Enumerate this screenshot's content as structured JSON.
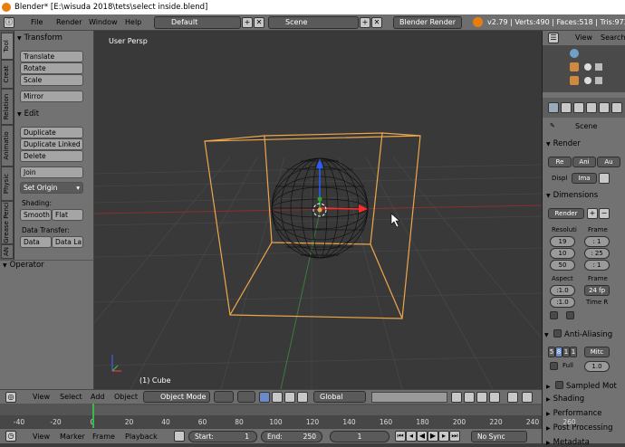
{
  "window": {
    "title": "Blender* [E:\\wisuda 2018\\tets\\select inside.blend]"
  },
  "info_header": {
    "menus": [
      "File",
      "Render",
      "Window",
      "Help"
    ],
    "screen_layout": "Default",
    "scene": "Scene",
    "engine": "Blender Render",
    "stats": "v2.79 | Verts:490 | Faces:518 | Tris:972 | O"
  },
  "tool_tabs": [
    "Tool",
    "Creat",
    "Relation",
    "Animatio",
    "Physic",
    "Grease Penci",
    "AN"
  ],
  "tool_shelf": {
    "transform": {
      "title": "Transform",
      "buttons": [
        "Translate",
        "Rotate",
        "Scale",
        "Mirror"
      ]
    },
    "edit": {
      "title": "Edit",
      "buttons": [
        "Duplicate",
        "Duplicate Linked",
        "Delete",
        "Join"
      ],
      "set_origin": "Set Origin"
    },
    "shading": {
      "label": "Shading:",
      "smooth": "Smooth",
      "flat": "Flat"
    },
    "data_transfer": {
      "label": "Data Transfer:",
      "data": "Data",
      "data_layers": "Data La"
    }
  },
  "operator_panel": {
    "title": "Operator"
  },
  "viewport": {
    "view_label": "User Persp",
    "object_label": "(1) Cube"
  },
  "viewport_header": {
    "menus": [
      "View",
      "Select",
      "Add",
      "Object"
    ],
    "mode": "Object Mode",
    "pivot": "Global"
  },
  "outliner": {
    "view": "View",
    "search": "Search"
  },
  "properties": {
    "scene": "Scene",
    "render": {
      "title": "Render",
      "tabs": [
        "Re",
        "Ani",
        "Au"
      ],
      "display_label": "Displ",
      "display_value": "Ima"
    },
    "dimensions": {
      "title": "Dimensions",
      "preset": "Render",
      "resolution_label": "Resoluti",
      "res_x": "19",
      "res_y": "10",
      "res_pct": "50",
      "frame_label": "Frame",
      "frame_start": ": 1",
      "frame_end": ": 25",
      "frame_step": ": 1",
      "aspect_label": "Aspect",
      "aspect_x": ":1.0",
      "aspect_y": ":1.0",
      "fps_label": "Frame",
      "fps": "24 fp",
      "time_remap": "Time R"
    },
    "anti_aliasing": {
      "title": "Anti-Aliasing",
      "samples": [
        "5",
        "8",
        "1",
        "1"
      ],
      "filter": "Mitc",
      "full_label": "Full",
      "filter_size": "1.0"
    },
    "sampled_motion": "Sampled Mot",
    "shading": "Shading",
    "performance": "Performance",
    "post_processing": "Post Processing",
    "metadata": "Metadata"
  },
  "timeline": {
    "ticks": [
      "-40",
      "-20",
      "0",
      "20",
      "40",
      "60",
      "80",
      "100",
      "120",
      "140",
      "160",
      "180",
      "200",
      "220",
      "240",
      "260"
    ],
    "menus": [
      "View",
      "Marker",
      "Frame",
      "Playback"
    ],
    "start": "Start:",
    "start_value": "1",
    "end": "End:",
    "end_value": "250",
    "current": "1",
    "sync": "No Sync"
  }
}
